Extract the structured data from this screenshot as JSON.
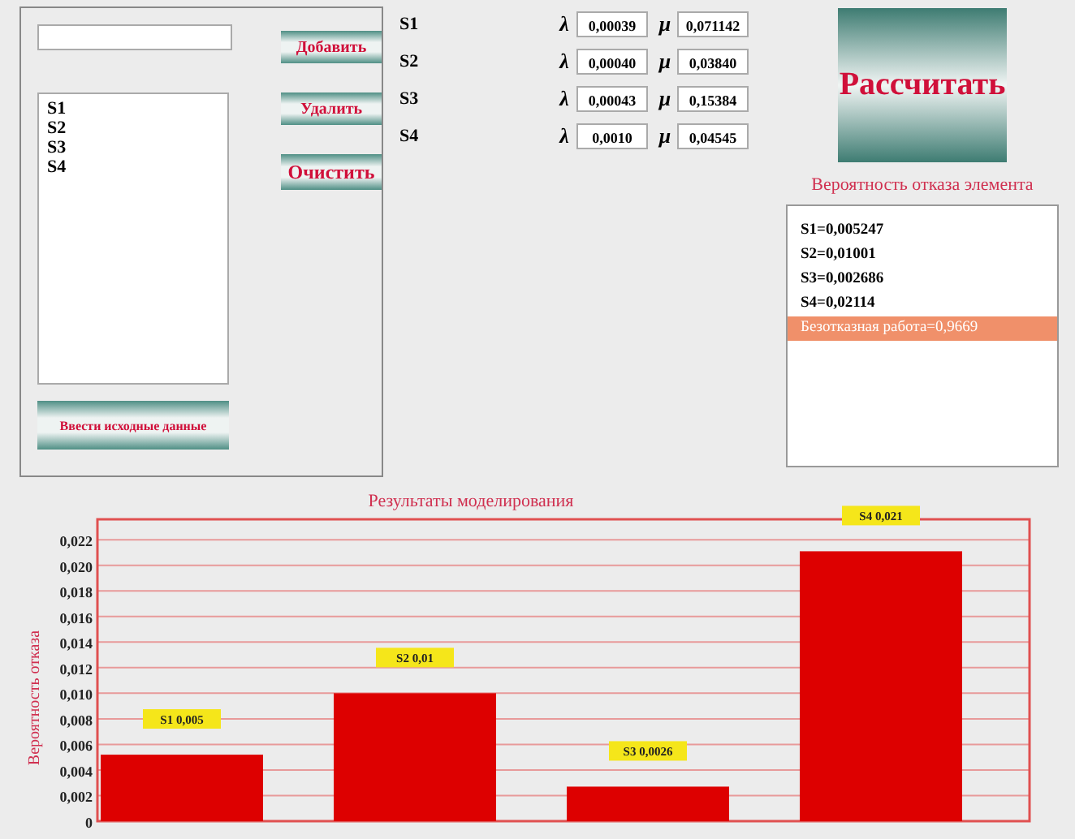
{
  "left_panel": {
    "buttons": [
      {
        "label": "Добавить"
      },
      {
        "label": "Удалить"
      },
      {
        "label": "Очистить"
      }
    ],
    "element_list": [
      "S1",
      "S2",
      "S3",
      "S4"
    ],
    "input_button": {
      "label": "Ввести исходные данные"
    }
  },
  "parameters": [
    {
      "name": "S1",
      "lambda_symbol": "λ",
      "lambda": "0,00039",
      "mu_symbol": "μ",
      "mu": "0,071142"
    },
    {
      "name": "S2",
      "lambda_symbol": "λ",
      "lambda": "0,00040",
      "mu_symbol": "μ",
      "mu": "0,03840"
    },
    {
      "name": "S3",
      "lambda_symbol": "λ",
      "lambda": "0,00043",
      "mu_symbol": "μ",
      "mu": "0,15384"
    },
    {
      "name": "S4",
      "lambda_symbol": "λ",
      "lambda": "0,0010",
      "mu_symbol": "μ",
      "mu": "0,04545"
    }
  ],
  "calculate_button": {
    "label": "Рассчитать"
  },
  "results": {
    "title": "Вероятность отказа элемента",
    "items": [
      {
        "text": "S1=0,005247",
        "selected": false
      },
      {
        "text": "S2=0,01001",
        "selected": false
      },
      {
        "text": "S3=0,002686",
        "selected": false
      },
      {
        "text": "S4=0,02114",
        "selected": false
      },
      {
        "text": "Безотказная работа=0,9669",
        "selected": true
      }
    ]
  },
  "chart": {
    "chart_data": {
      "type": "bar",
      "title": "Результаты моделирования",
      "ylabel": "Вероятность отказа",
      "grid": true,
      "series": [
        {
          "color": "#dd0000",
          "values": [
            0.0052,
            0.01,
            0.0027,
            0.0211
          ]
        }
      ],
      "ylim": [
        0,
        0.0236
      ],
      "yticks": [
        {
          "value": 0,
          "label": "0"
        },
        {
          "value": 0.002,
          "label": "0,002"
        },
        {
          "value": 0.004,
          "label": "0,004"
        },
        {
          "value": 0.006,
          "label": "0,006"
        },
        {
          "value": 0.008,
          "label": "0,008"
        },
        {
          "value": 0.01,
          "label": "0,010"
        },
        {
          "value": 0.012,
          "label": "0,012"
        },
        {
          "value": 0.014,
          "label": "0,014"
        },
        {
          "value": 0.016,
          "label": "0,016"
        },
        {
          "value": 0.018,
          "label": "0,018"
        },
        {
          "value": 0.02,
          "label": "0,020"
        },
        {
          "value": 0.022,
          "label": "0,022"
        }
      ],
      "value_labels": [
        "S1 0,005",
        "S2 0,01",
        "S3 0,0026",
        "S4 0,021"
      ]
    }
  }
}
